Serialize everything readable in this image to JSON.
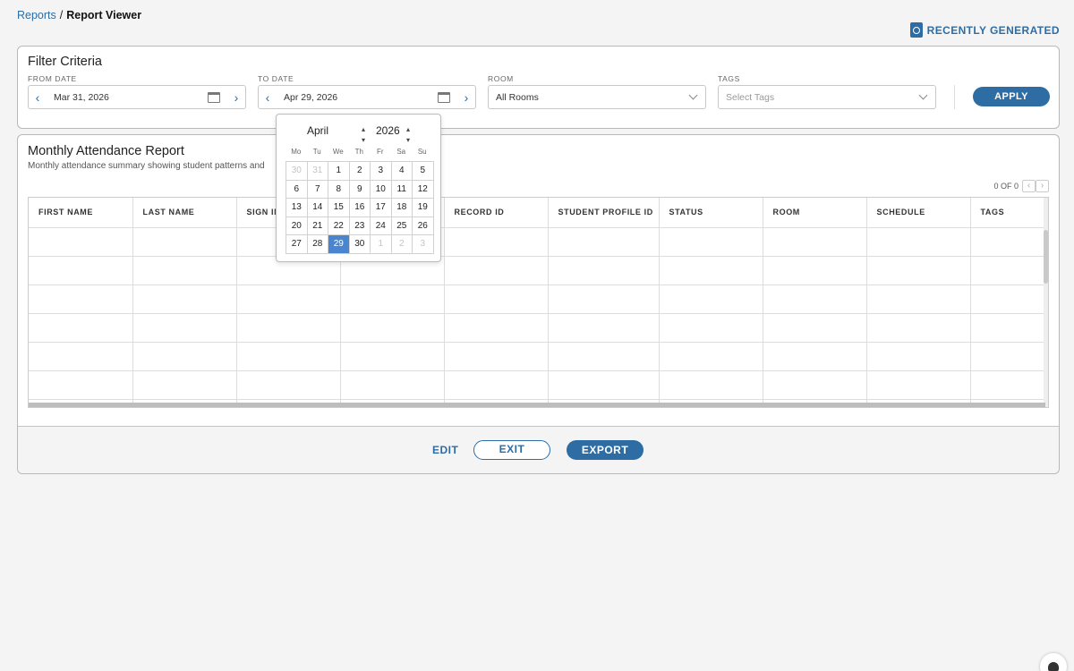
{
  "breadcrumb": {
    "root": "Reports",
    "sep": "/",
    "current": "Report Viewer"
  },
  "recent": {
    "label": "RECENTLY GENERATED",
    "icon": "history-doc-icon"
  },
  "filter": {
    "title": "Filter Criteria",
    "from_label": "FROM DATE",
    "from_value": "Mar 31, 2026",
    "to_label": "TO DATE",
    "to_value": "Apr 29, 2026",
    "room_label": "ROOM",
    "room_value": "All Rooms",
    "tags_label": "TAGS",
    "tags_placeholder": "Select Tags",
    "apply_label": "APPLY"
  },
  "report": {
    "title": "Monthly Attendance Report",
    "subtitle": "Monthly attendance summary showing student patterns and",
    "pager_text": "0 OF 0",
    "columns": [
      "FIRST NAME",
      "LAST NAME",
      "SIGN IN",
      "",
      "RECORD ID",
      "STUDENT PROFILE ID",
      "STATUS",
      "ROOM",
      "SCHEDULE",
      "TAGS"
    ]
  },
  "footer": {
    "edit": "EDIT",
    "exit": "EXIT",
    "export": "EXPORT"
  },
  "datepicker": {
    "month": "April",
    "year": "2026",
    "dow": [
      "Mo",
      "Tu",
      "We",
      "Th",
      "Fr",
      "Sa",
      "Su"
    ],
    "weeks": [
      [
        {
          "d": "30",
          "m": true
        },
        {
          "d": "31",
          "m": true
        },
        {
          "d": "1"
        },
        {
          "d": "2"
        },
        {
          "d": "3"
        },
        {
          "d": "4"
        },
        {
          "d": "5"
        }
      ],
      [
        {
          "d": "6"
        },
        {
          "d": "7"
        },
        {
          "d": "8"
        },
        {
          "d": "9"
        },
        {
          "d": "10"
        },
        {
          "d": "11"
        },
        {
          "d": "12"
        }
      ],
      [
        {
          "d": "13"
        },
        {
          "d": "14"
        },
        {
          "d": "15"
        },
        {
          "d": "16"
        },
        {
          "d": "17"
        },
        {
          "d": "18"
        },
        {
          "d": "19"
        }
      ],
      [
        {
          "d": "20"
        },
        {
          "d": "21"
        },
        {
          "d": "22"
        },
        {
          "d": "23"
        },
        {
          "d": "24"
        },
        {
          "d": "25"
        },
        {
          "d": "26"
        }
      ],
      [
        {
          "d": "27"
        },
        {
          "d": "28"
        },
        {
          "d": "29",
          "s": true
        },
        {
          "d": "30"
        },
        {
          "d": "1",
          "m": true
        },
        {
          "d": "2",
          "m": true
        },
        {
          "d": "3",
          "m": true
        }
      ]
    ]
  },
  "colors": {
    "accent": "#2e6da4",
    "selected_day": "#4a86d0"
  }
}
